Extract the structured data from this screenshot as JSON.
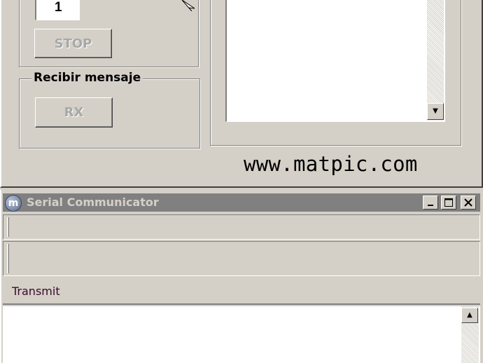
{
  "upper_window": {
    "counter_value": "1",
    "stop_button": "STOP",
    "receive_group": {
      "title": "Recibir mensaje",
      "rx_button": "RX"
    },
    "website": "www.matpic.com",
    "scroll_down_glyph": "▼"
  },
  "serial_window": {
    "title": "Serial Communicator",
    "icon_letter": "m",
    "caption_buttons": {
      "minimize": "minimize-icon",
      "maximize": "maximize-icon",
      "close": "close-icon"
    },
    "transmit_label": "Transmit",
    "scroll_up_glyph": "▲"
  }
}
